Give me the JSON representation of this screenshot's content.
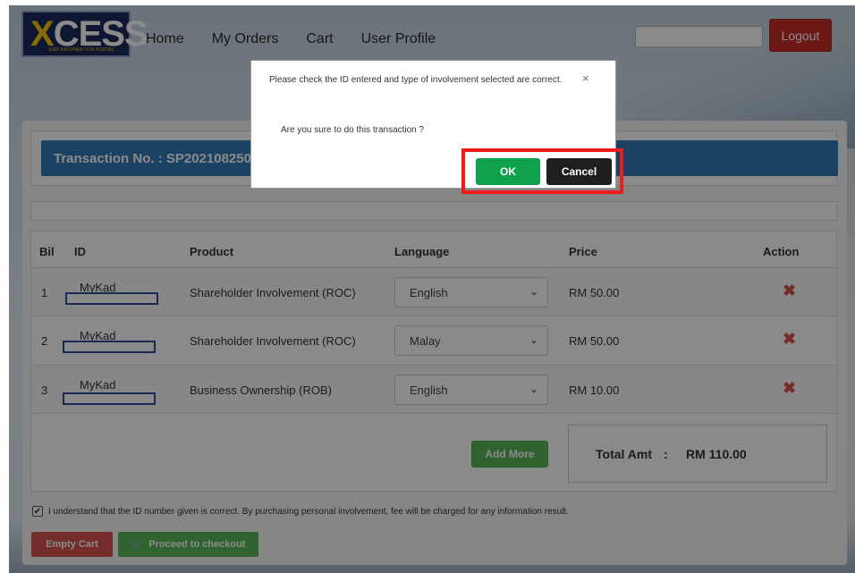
{
  "header": {
    "logo_text": "XCESS",
    "logo_subtext": "SSM INFORMATION PORTAL",
    "nav": [
      "Home",
      "My Orders",
      "Cart",
      "User Profile"
    ],
    "search_value": "",
    "logout_label": "Logout"
  },
  "transaction": {
    "label": "Transaction No. : SP20210825000"
  },
  "table": {
    "headers": {
      "bil": "Bil",
      "id": "ID",
      "product": "Product",
      "language": "Language",
      "price": "Price",
      "action": "Action"
    },
    "rows": [
      {
        "bil": "1",
        "id_type": "MyKad",
        "id_value": "",
        "product": "Shareholder Involvement (ROC)",
        "language": "English",
        "price": "RM 50.00"
      },
      {
        "bil": "2",
        "id_type": "MyKad",
        "id_value": "",
        "product": "Shareholder Involvement (ROC)",
        "language": "Malay",
        "price": "RM 50.00"
      },
      {
        "bil": "3",
        "id_type": "MyKad",
        "id_value": "",
        "product": "Business Ownership (ROB)",
        "language": "English",
        "price": "RM 10.00"
      }
    ],
    "add_more_label": "Add More",
    "total_label": "Total Amt",
    "total_sep": ":",
    "total_value": "RM 110.00"
  },
  "consent_text": "I understand that the ID number given is correct. By purchasing personal involvement, fee will be charged for any information result.",
  "buttons": {
    "empty_cart": "Empty Cart",
    "checkout": "Proceed to checkout"
  },
  "modal": {
    "message": "Please check the ID entered and type of involvement selected are correct.",
    "question": "Are you sure to do this transaction ?",
    "close_symbol": "×",
    "ok_label": "OK",
    "cancel_label": "Cancel"
  },
  "colors": {
    "primary_blue": "#337ab7",
    "logout_red": "#c9302c",
    "ok_green": "#10a24b",
    "cancel_black": "#1f1f1f",
    "highlight_red": "#ef1c1c"
  }
}
